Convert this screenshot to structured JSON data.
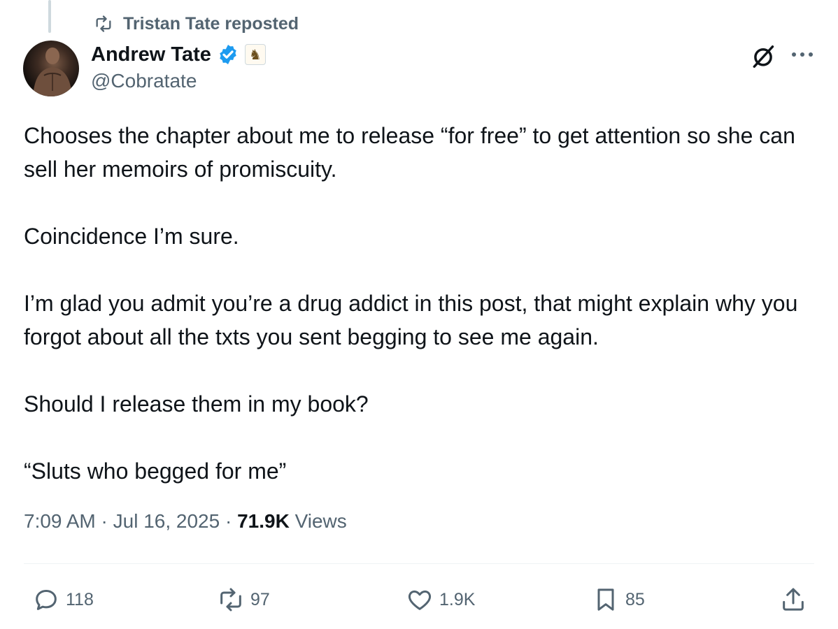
{
  "repost": {
    "label": "Tristan Tate reposted",
    "icon": "repost-icon"
  },
  "author": {
    "display_name": "Andrew Tate",
    "handle": "@Cobratate",
    "verified_color": "#1d9bf0",
    "affiliate_badge": "♞"
  },
  "post": {
    "paragraphs": [
      "Chooses the chapter about me to release “for free” to get attention so she can sell her memoirs of promiscuity.",
      "Coincidence I’m sure.",
      "I’m glad you admit you’re a drug addict in this post, that might explain why you forgot about all the txts you sent begging to see me again.",
      "Should I release them in my book?",
      "“Sluts who begged for me”"
    ]
  },
  "meta": {
    "time": "7:09 AM",
    "date": "Jul 16, 2025",
    "separator": " · ",
    "views_count": "71.9K",
    "views_label": " Views"
  },
  "actions": {
    "replies": "118",
    "reposts": "97",
    "likes": "1.9K",
    "bookmarks": "85"
  },
  "colors": {
    "text": "#0f1419",
    "secondary": "#536471",
    "accent": "#1d9bf0",
    "divider": "#eff3f4"
  }
}
